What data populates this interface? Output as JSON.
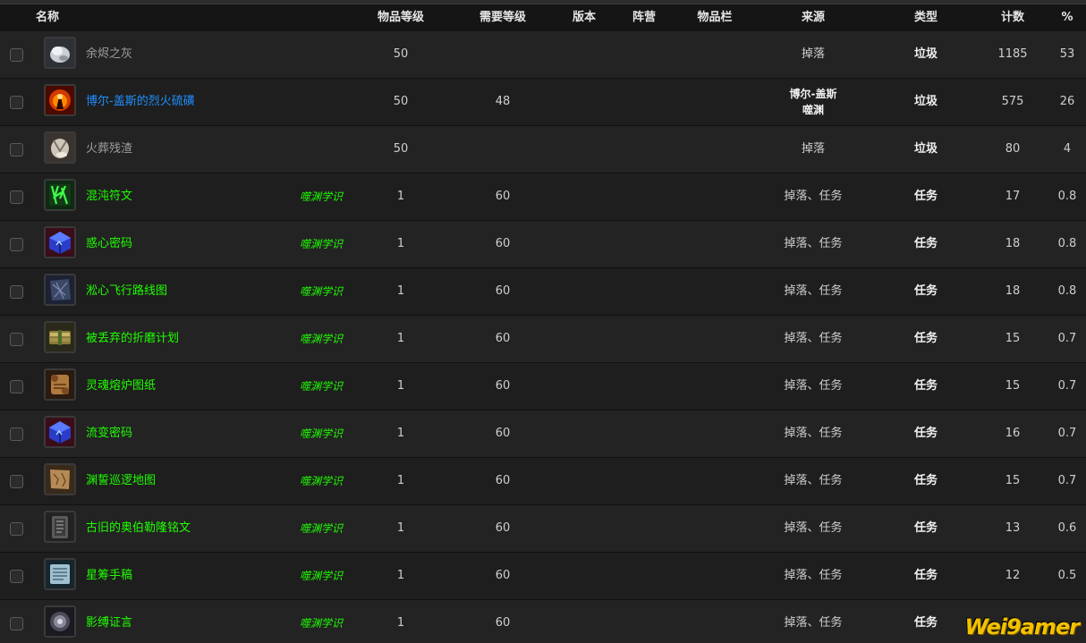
{
  "header": {
    "name": "名称",
    "item_level": "物品等级",
    "req_level": "需要等级",
    "version": "版本",
    "faction": "阵营",
    "slot": "物品栏",
    "source": "来源",
    "type": "类型",
    "count": "计数",
    "percent": "%"
  },
  "colors": {
    "junk": "#9d9d9d",
    "blue": "#1e90ff",
    "green": "#1eff00"
  },
  "rows": [
    {
      "name": "余烬之灰",
      "quality": "junk",
      "icon": "ash-icon",
      "tag": "",
      "item_level": "50",
      "req_level": "",
      "source": "掉落",
      "source_lines": [],
      "type": "垃圾",
      "count": "1185",
      "percent": "53"
    },
    {
      "name": "博尔-盖斯的烈火硫磺",
      "quality": "blue",
      "icon": "fire-sulfur-icon",
      "tag": "",
      "item_level": "50",
      "req_level": "48",
      "source": "",
      "source_lines": [
        "博尔-盖斯",
        "噬渊"
      ],
      "type": "垃圾",
      "count": "575",
      "percent": "26"
    },
    {
      "name": "火葬残渣",
      "quality": "junk",
      "icon": "cremation-dust-icon",
      "tag": "",
      "item_level": "50",
      "req_level": "",
      "source": "掉落",
      "source_lines": [],
      "type": "垃圾",
      "count": "80",
      "percent": "4"
    },
    {
      "name": "混沌符文",
      "quality": "green",
      "icon": "chaos-rune-icon",
      "tag": "噬渊学识",
      "item_level": "1",
      "req_level": "60",
      "source": "掉落、任务",
      "source_lines": [],
      "type": "任务",
      "count": "17",
      "percent": "0.8"
    },
    {
      "name": "惑心密码",
      "quality": "green",
      "icon": "cipher-cube-icon",
      "tag": "噬渊学识",
      "item_level": "1",
      "req_level": "60",
      "source": "掉落、任务",
      "source_lines": [],
      "type": "任务",
      "count": "18",
      "percent": "0.8"
    },
    {
      "name": "淞心飞行路线图",
      "quality": "green",
      "icon": "flight-map-icon",
      "tag": "噬渊学识",
      "item_level": "1",
      "req_level": "60",
      "source": "掉落、任务",
      "source_lines": [],
      "type": "任务",
      "count": "18",
      "percent": "0.8"
    },
    {
      "name": "被丢弃的折磨计划",
      "quality": "green",
      "icon": "scroll-bundle-icon",
      "tag": "噬渊学识",
      "item_level": "1",
      "req_level": "60",
      "source": "掉落、任务",
      "source_lines": [],
      "type": "任务",
      "count": "15",
      "percent": "0.7"
    },
    {
      "name": "灵魂熔炉图纸",
      "quality": "green",
      "icon": "blueprint-scroll-icon",
      "tag": "噬渊学识",
      "item_level": "1",
      "req_level": "60",
      "source": "掉落、任务",
      "source_lines": [],
      "type": "任务",
      "count": "15",
      "percent": "0.7"
    },
    {
      "name": "流变密码",
      "quality": "green",
      "icon": "cipher-cube-icon",
      "tag": "噬渊学识",
      "item_level": "1",
      "req_level": "60",
      "source": "掉落、任务",
      "source_lines": [],
      "type": "任务",
      "count": "16",
      "percent": "0.7"
    },
    {
      "name": "渊誓巡逻地图",
      "quality": "green",
      "icon": "patrol-map-icon",
      "tag": "噬渊学识",
      "item_level": "1",
      "req_level": "60",
      "source": "掉落、任务",
      "source_lines": [],
      "type": "任务",
      "count": "15",
      "percent": "0.7"
    },
    {
      "name": "古旧的奥伯勒隆铭文",
      "quality": "green",
      "icon": "inscription-tablet-icon",
      "tag": "噬渊学识",
      "item_level": "1",
      "req_level": "60",
      "source": "掉落、任务",
      "source_lines": [],
      "type": "任务",
      "count": "13",
      "percent": "0.6"
    },
    {
      "name": "星筹手稿",
      "quality": "green",
      "icon": "manuscript-icon",
      "tag": "噬渊学识",
      "item_level": "1",
      "req_level": "60",
      "source": "掉落、任务",
      "source_lines": [],
      "type": "任务",
      "count": "12",
      "percent": "0.5"
    },
    {
      "name": "影缚证言",
      "quality": "green",
      "icon": "shadow-testimony-icon",
      "tag": "噬渊学识",
      "item_level": "1",
      "req_level": "60",
      "source": "掉落、任务",
      "source_lines": [],
      "type": "任务",
      "count": "",
      "percent": ""
    }
  ],
  "watermark": "Wei9amer"
}
